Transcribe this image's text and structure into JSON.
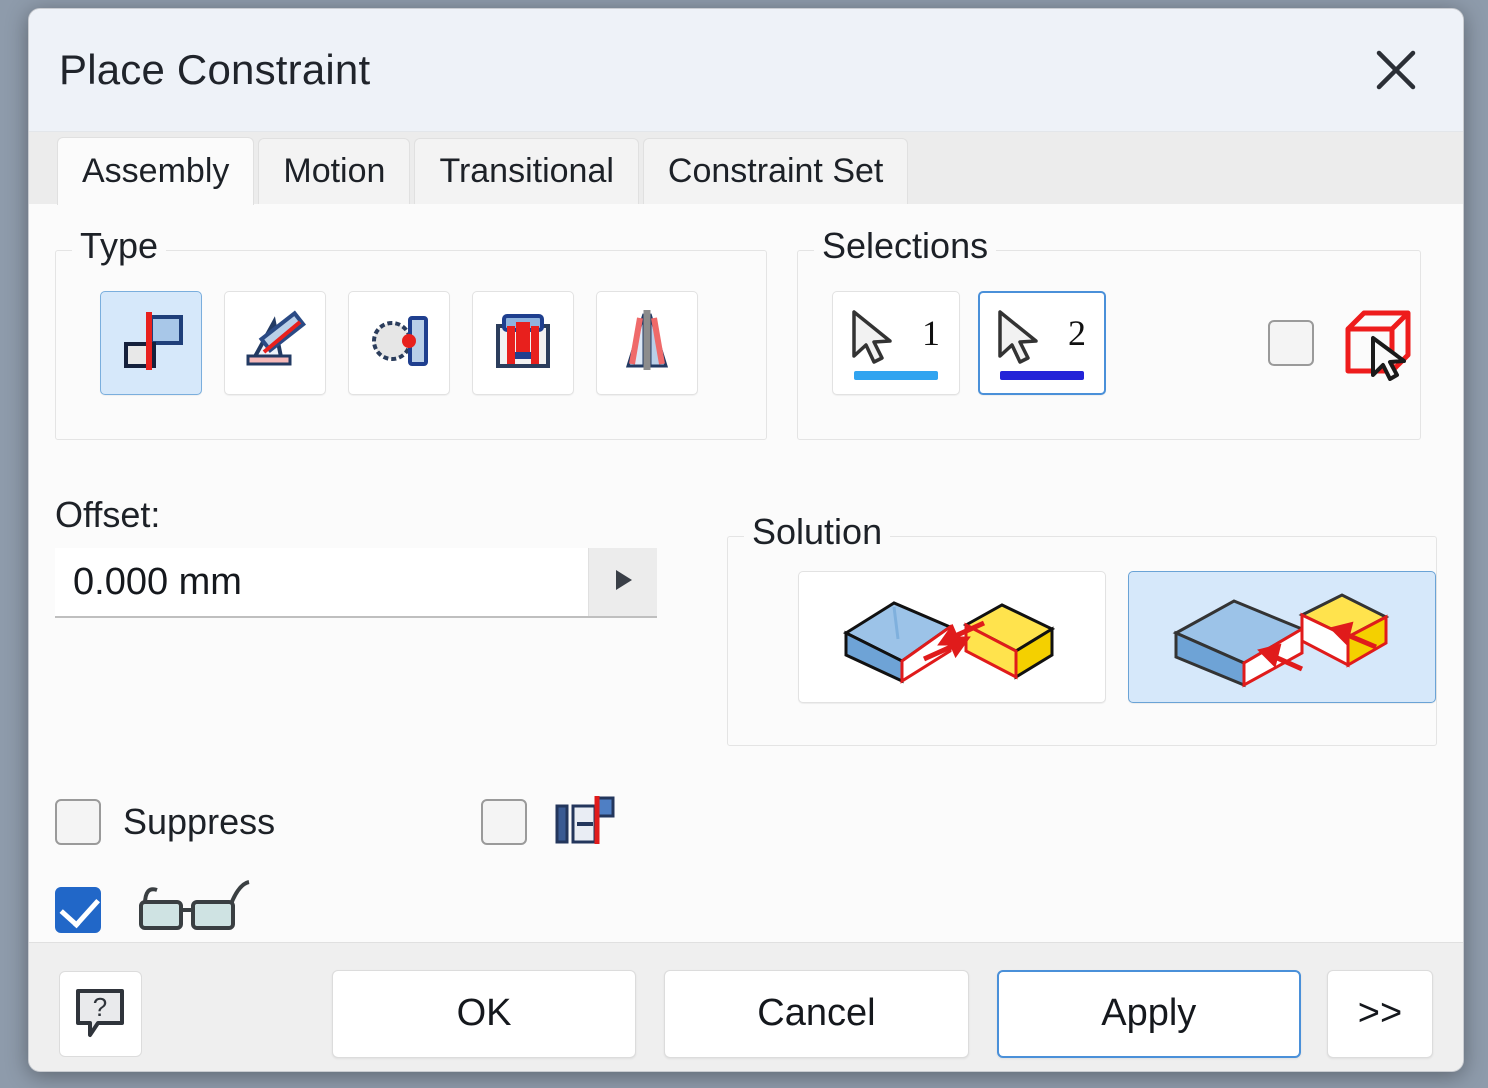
{
  "window": {
    "title": "Place Constraint",
    "close_icon": "close-icon"
  },
  "tabs": [
    {
      "label": "Assembly",
      "active": true
    },
    {
      "label": "Motion",
      "active": false
    },
    {
      "label": "Transitional",
      "active": false
    },
    {
      "label": "Constraint Set",
      "active": false
    }
  ],
  "type_group": {
    "legend": "Type",
    "items": [
      {
        "name": "mate-constraint",
        "icon": "mate-icon",
        "selected": true
      },
      {
        "name": "angle-constraint",
        "icon": "angle-icon",
        "selected": false
      },
      {
        "name": "tangent-constraint",
        "icon": "tangent-icon",
        "selected": false
      },
      {
        "name": "insert-constraint",
        "icon": "insert-icon",
        "selected": false
      },
      {
        "name": "symmetry-constraint",
        "icon": "symmetry-icon",
        "selected": false
      }
    ]
  },
  "selections_group": {
    "legend": "Selections",
    "picks": [
      {
        "number": "1",
        "underline_color": "#31a4f0",
        "active": false
      },
      {
        "number": "2",
        "underline_color": "#2323d8",
        "active": true
      }
    ],
    "pick_part_first": {
      "checked": false,
      "icon": "pick-part-first-icon"
    }
  },
  "offset": {
    "label": "Offset:",
    "value": "0.000 mm",
    "placeholder": "0.000 mm",
    "arrow_icon": "triangle-right-icon"
  },
  "solution_group": {
    "legend": "Solution",
    "items": [
      {
        "name": "mate-solution",
        "icon": "mate-solution-icon",
        "selected": false
      },
      {
        "name": "flush-solution",
        "icon": "flush-solution-icon",
        "selected": true
      }
    ]
  },
  "options": {
    "suppress": {
      "label": "Suppress",
      "checked": false
    },
    "limits": {
      "checked": false,
      "icon": "constraint-limits-icon"
    },
    "show_preview": {
      "checked": true,
      "icon": "glasses-icon"
    }
  },
  "footer": {
    "help_label": "?",
    "ok_label": "OK",
    "cancel_label": "Cancel",
    "apply_label": "Apply",
    "expand_label": ">>"
  },
  "colors": {
    "accent": "#4a90d9",
    "selected_tile_bg": "#d6e8fa",
    "checkbox_checked": "#2167c8",
    "title_bar": "#eef2f8",
    "pick1_underline": "#31a4f0",
    "pick2_underline": "#2323d8",
    "red_icon": "#ee1c1c"
  }
}
